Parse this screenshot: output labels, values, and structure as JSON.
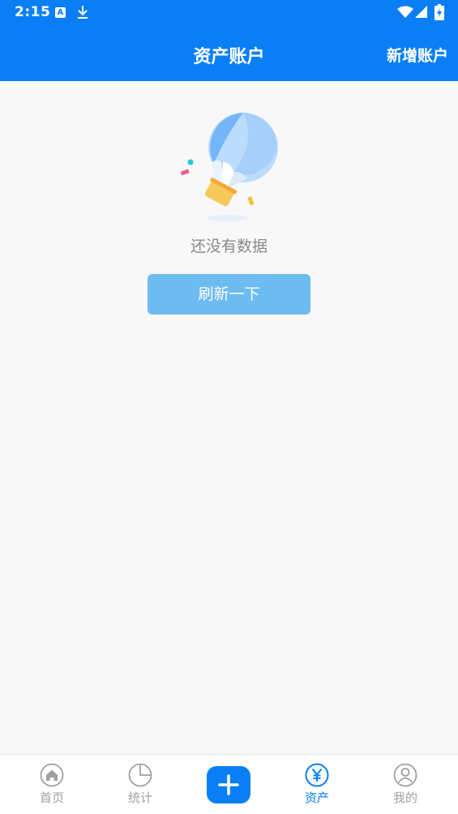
{
  "status_bar": {
    "time": "2:15",
    "notification_icon_letter": "A",
    "icons": [
      "a-notification-icon",
      "download-icon",
      "wifi-icon",
      "signal-icon",
      "battery-icon"
    ]
  },
  "header": {
    "title": "资产账户",
    "add_account_label": "新增账户",
    "background_color": "#0a7ff5"
  },
  "empty_state": {
    "message": "还没有数据",
    "refresh_label": "刷新一下",
    "illustration": "balloon-illustration",
    "button_color": "#6cbcf2"
  },
  "tab_bar": {
    "active_color": "#0a7ff5",
    "inactive_color": "#a0a0a0",
    "tabs": [
      {
        "label": "首页",
        "icon": "home-icon",
        "active": false
      },
      {
        "label": "统计",
        "icon": "pie-chart-icon",
        "active": false
      },
      {
        "label": "资产",
        "icon": "yen-icon",
        "active": true
      },
      {
        "label": "我的",
        "icon": "user-icon",
        "active": false
      }
    ],
    "add_icon": "plus-icon"
  }
}
